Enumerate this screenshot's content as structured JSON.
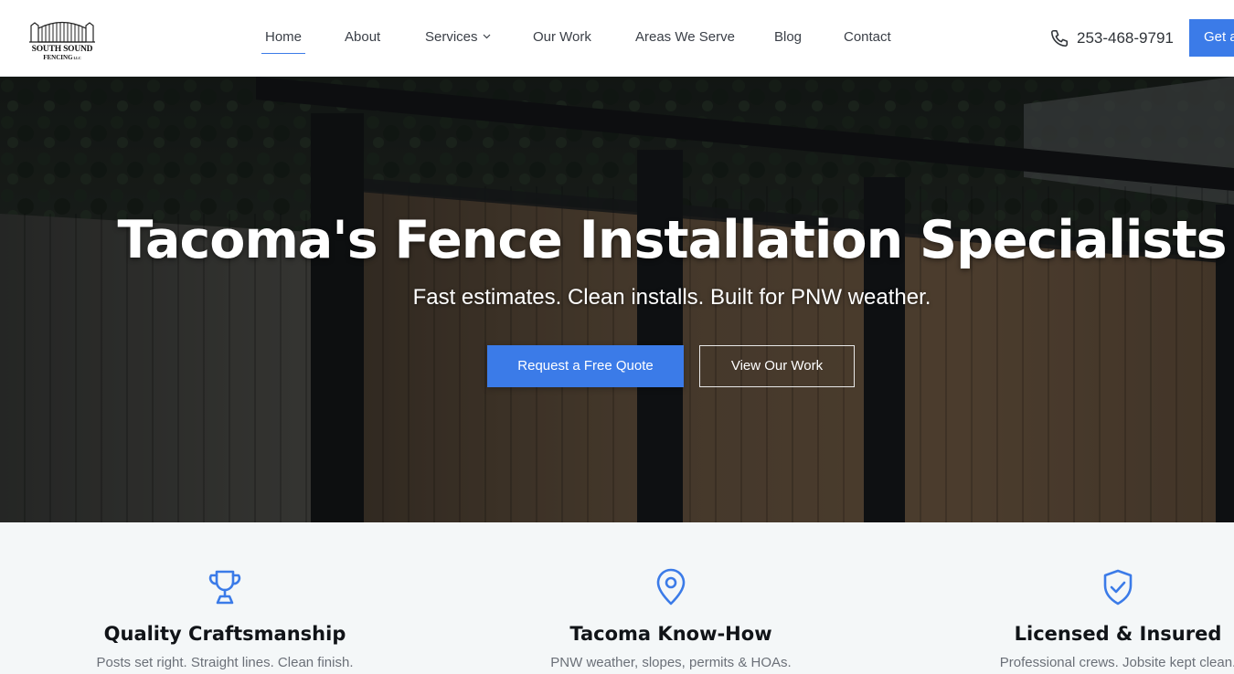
{
  "brand": {
    "line1": "SOUTH SOUND",
    "line2": "FENCING",
    "suffix": "LLC"
  },
  "nav": {
    "items": [
      {
        "label": "Home",
        "active": true
      },
      {
        "label": "About"
      },
      {
        "label": "Services",
        "has_dropdown": true
      },
      {
        "label": "Our Work"
      },
      {
        "label": "Areas We Serve"
      },
      {
        "label": "Blog"
      },
      {
        "label": "Contact"
      }
    ],
    "phone": "253-468-9791",
    "phone_icon": "phone-icon",
    "cta_label": "Get a",
    "dropdown_icon": "chevron-down-icon"
  },
  "hero": {
    "title": "Tacoma's Fence Installation Specialists",
    "subtitle": "Fast estimates. Clean installs. Built for PNW weather.",
    "primary_button": "Request a Free Quote",
    "secondary_button": "View Our Work"
  },
  "features": [
    {
      "icon": "trophy-icon",
      "title": "Quality Craftsmanship",
      "description": "Posts set right. Straight lines. Clean finish."
    },
    {
      "icon": "map-pin-icon",
      "title": "Tacoma Know-How",
      "description": "PNW weather, slopes, permits & HOAs."
    },
    {
      "icon": "shield-check-icon",
      "title": "Licensed & Insured",
      "description": "Professional crews. Jobsite kept clean."
    }
  ],
  "colors": {
    "accent": "#3b7be8",
    "text_dark": "#111418",
    "text_muted": "#6b7078",
    "section_bg": "#f4f7f8"
  }
}
